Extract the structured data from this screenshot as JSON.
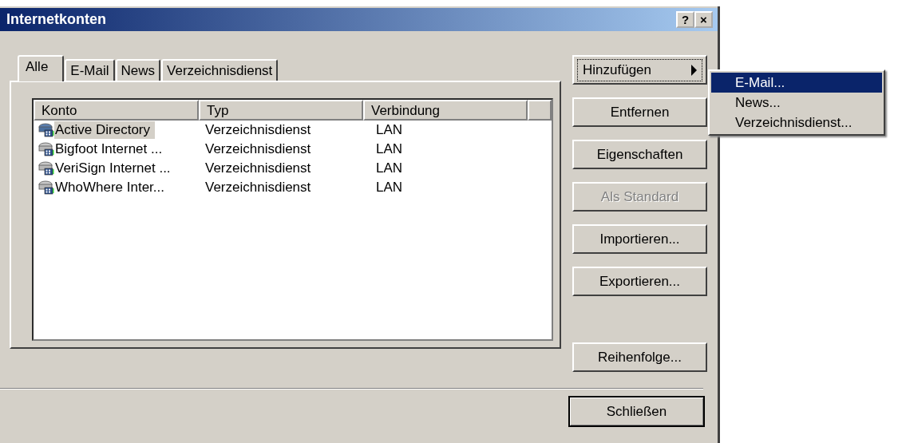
{
  "window": {
    "title": "Internetkonten",
    "title_buttons": [
      "?",
      "×"
    ]
  },
  "tabs": [
    {
      "label": "Alle",
      "selected": true
    },
    {
      "label": "E-Mail",
      "selected": false
    },
    {
      "label": "News",
      "selected": false
    },
    {
      "label": "Verzeichnisdienst",
      "selected": false
    }
  ],
  "table": {
    "columns": [
      "Konto",
      "Typ",
      "Verbindung"
    ],
    "rows": [
      {
        "cells": [
          "Active Directory",
          "Verzeichnisdienst",
          "LAN"
        ],
        "selected": true
      },
      {
        "cells": [
          "Bigfoot Internet ...",
          "Verzeichnisdienst",
          "LAN"
        ],
        "selected": false
      },
      {
        "cells": [
          "VeriSign Internet ...",
          "Verzeichnisdienst",
          "LAN"
        ],
        "selected": false
      },
      {
        "cells": [
          "WhoWhere Inter...",
          "Verzeichnisdienst",
          "LAN"
        ],
        "selected": false
      }
    ]
  },
  "buttons": [
    {
      "label": "Hinzufügen",
      "kind": "submenu",
      "disabled": false,
      "focused": true
    },
    {
      "label": "Entfernen",
      "kind": "push",
      "disabled": false,
      "focused": false
    },
    {
      "label": "Eigenschaften",
      "kind": "push",
      "disabled": false,
      "focused": false
    },
    {
      "label": "Als Standard",
      "kind": "push",
      "disabled": true,
      "focused": false
    },
    {
      "label": "Importieren...",
      "kind": "push",
      "disabled": false,
      "focused": false
    },
    {
      "label": "Exportieren...",
      "kind": "push",
      "disabled": false,
      "focused": false
    },
    {
      "label": "Reihenfolge...",
      "kind": "push",
      "disabled": false,
      "focused": false
    }
  ],
  "close_button": {
    "label": "Schließen"
  },
  "submenu": [
    {
      "label": "E-Mail...",
      "selected": true
    },
    {
      "label": "News...",
      "selected": false
    },
    {
      "label": "Verzeichnisdienst...",
      "selected": false
    }
  ]
}
